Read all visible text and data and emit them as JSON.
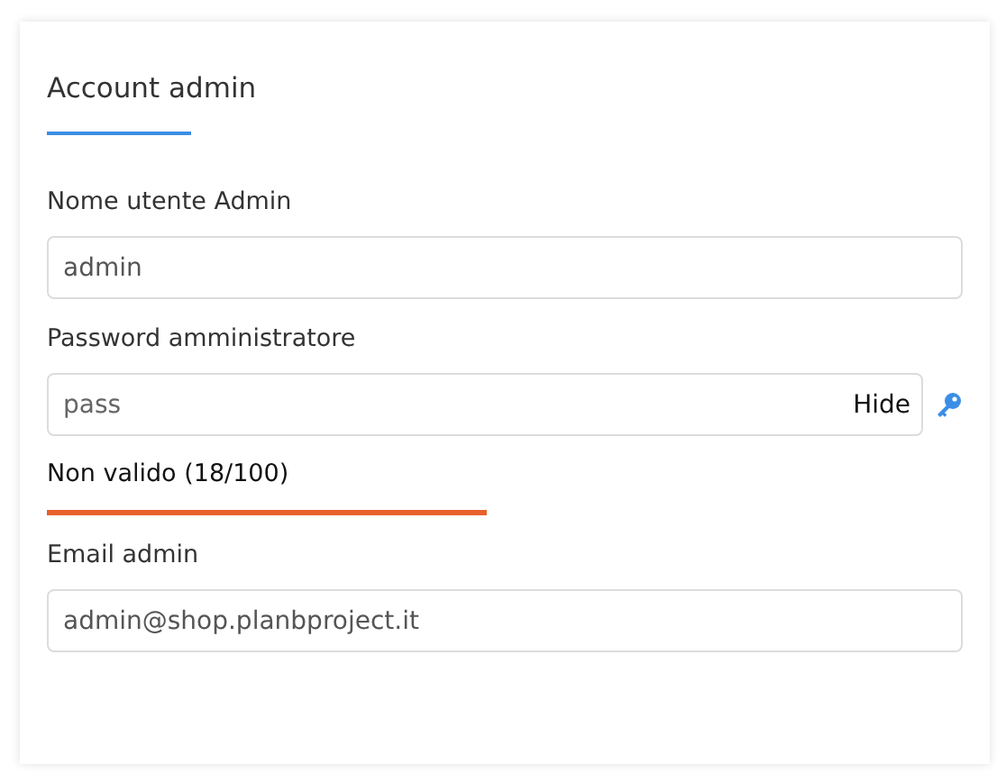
{
  "section": {
    "title": "Account admin"
  },
  "fields": [
    {
      "kind": "text",
      "label": "Nome utente Admin",
      "value": "admin"
    },
    {
      "kind": "password",
      "label": "Password amministratore",
      "value": "pass",
      "toggle": "Hide",
      "strength": {
        "text": "Non valido (18/100)",
        "color": "#e8602c"
      }
    },
    {
      "kind": "text",
      "label": "Email admin",
      "value": "admin@shop.planbproject.it"
    }
  ]
}
